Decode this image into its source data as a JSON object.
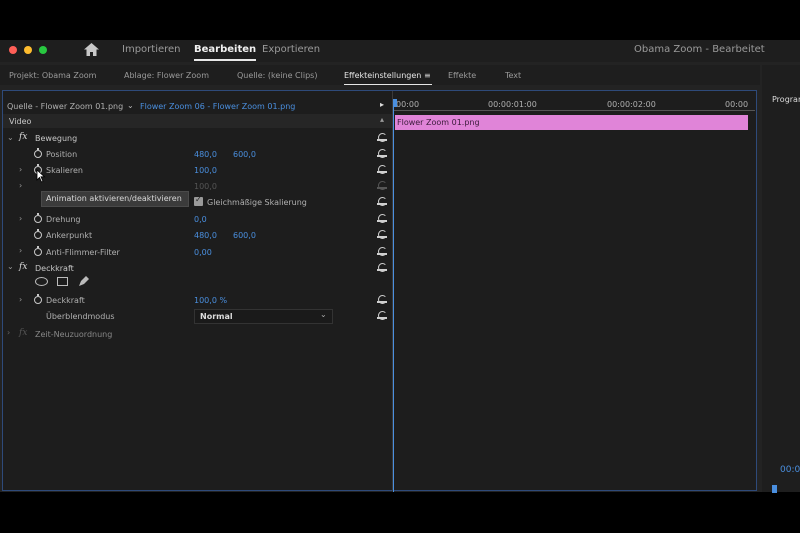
{
  "window": {
    "title": "Obama Zoom - Bearbeitet",
    "menu": [
      "Importieren",
      "Bearbeiten",
      "Exportieren"
    ],
    "traffic_colors": [
      "#ff5f57",
      "#febc2e",
      "#28c840"
    ]
  },
  "tabs": {
    "items": [
      "Projekt: Obama Zoom",
      "Ablage: Flower Zoom",
      "Quelle: (keine Clips)",
      "Effekteinstellungen",
      "Effekte",
      "Text"
    ],
    "active": "Effekteinstellungen",
    "right_panel": "Program"
  },
  "source_bar": {
    "source": "Quelle - Flower Zoom 01.png",
    "sequence": "Flower Zoom 06 - Flower Zoom 01.png"
  },
  "timeline": {
    "times": [
      "00:00",
      "00:00:01:00",
      "00:00:02:00",
      "00:00"
    ],
    "clip_label": "Flower Zoom 01.png",
    "clip_color": "#e084d8"
  },
  "effects": {
    "video_header": "Video",
    "motion": {
      "label": "Bewegung",
      "position": {
        "label": "Position",
        "x": "480,0",
        "y": "600,0"
      },
      "scale": {
        "label": "Skalieren",
        "value": "100,0"
      },
      "scale_width": {
        "value": "100,0"
      },
      "uniform_scale": "Gleichmäßige Skalierung",
      "rotation": {
        "label": "Drehung",
        "value": "0,0"
      },
      "anchor": {
        "label": "Ankerpunkt",
        "x": "480,0",
        "y": "600,0"
      },
      "antiflicker": {
        "label": "Anti-Flimmer-Filter",
        "value": "0,00"
      }
    },
    "opacity": {
      "label": "Deckkraft",
      "opacity": {
        "label": "Deckkraft",
        "value": "100,0 %"
      },
      "blend_mode": {
        "label": "Überblendmodus",
        "value": "Normal"
      }
    },
    "time_remap": {
      "label": "Zeit-Neuzuordnung"
    }
  },
  "tooltip": "Animation aktivieren/deaktivieren",
  "monitor": {
    "timecode": "00:0"
  }
}
